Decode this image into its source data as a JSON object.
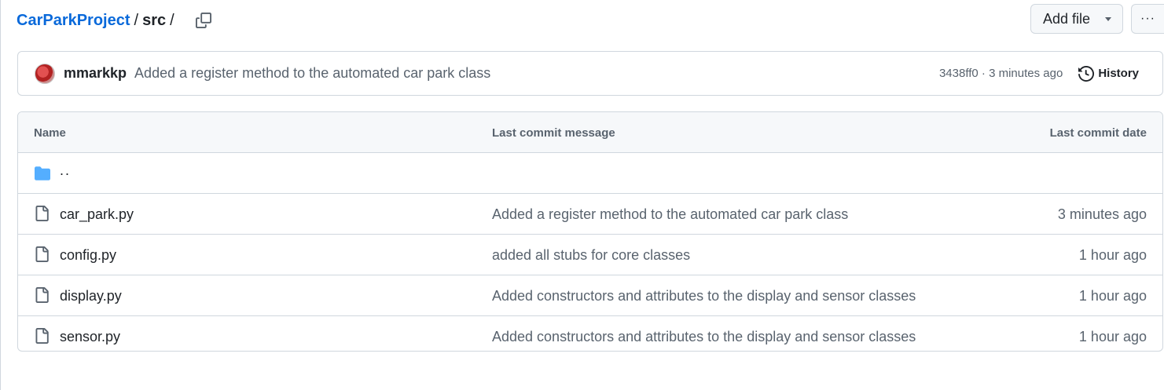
{
  "breadcrumb": {
    "repo": "CarParkProject",
    "sep1": "/",
    "folder": "src",
    "sep2": "/"
  },
  "toolbar": {
    "add_file_label": "Add file",
    "more_label": "···"
  },
  "latest_commit": {
    "author": "mmarkkp",
    "message": "Added a register method to the automated car park class",
    "sha_time": "3438ff0 · 3 minutes ago",
    "history_label": "History"
  },
  "table": {
    "headers": {
      "name": "Name",
      "message": "Last commit message",
      "date": "Last commit date"
    },
    "parent": "..",
    "rows": [
      {
        "name": "car_park.py",
        "message": "Added a register method to the automated car park class",
        "date": "3 minutes ago"
      },
      {
        "name": "config.py",
        "message": "added all stubs for core classes",
        "date": "1 hour ago"
      },
      {
        "name": "display.py",
        "message": "Added constructors and attributes to the display and sensor classes",
        "date": "1 hour ago"
      },
      {
        "name": "sensor.py",
        "message": "Added constructors and attributes to the display and sensor classes",
        "date": "1 hour ago"
      }
    ]
  },
  "colors": {
    "link": "#0969da",
    "folder": "#54aeff",
    "muted": "#59636e",
    "border": "#d0d7de"
  }
}
